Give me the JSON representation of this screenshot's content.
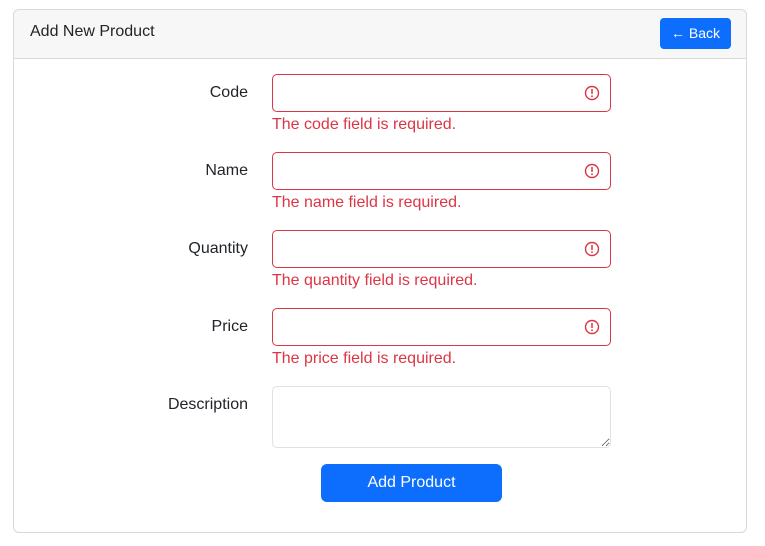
{
  "header": {
    "title": "Add New Product",
    "back_label": "← Back"
  },
  "form": {
    "fields": [
      {
        "label": "Code",
        "value": "",
        "error": "The code field is required."
      },
      {
        "label": "Name",
        "value": "",
        "error": "The name field is required."
      },
      {
        "label": "Quantity",
        "value": "",
        "error": "The quantity field is required."
      },
      {
        "label": "Price",
        "value": "",
        "error": "The price field is required."
      }
    ],
    "description": {
      "label": "Description",
      "value": ""
    },
    "submit_label": "Add Product"
  },
  "colors": {
    "primary": "#0d6efd",
    "danger": "#dc3545",
    "header_bg": "#f7f7f7",
    "border": "#d9d9d9"
  },
  "icons": {
    "field_error": "exclamation-circle-icon"
  }
}
